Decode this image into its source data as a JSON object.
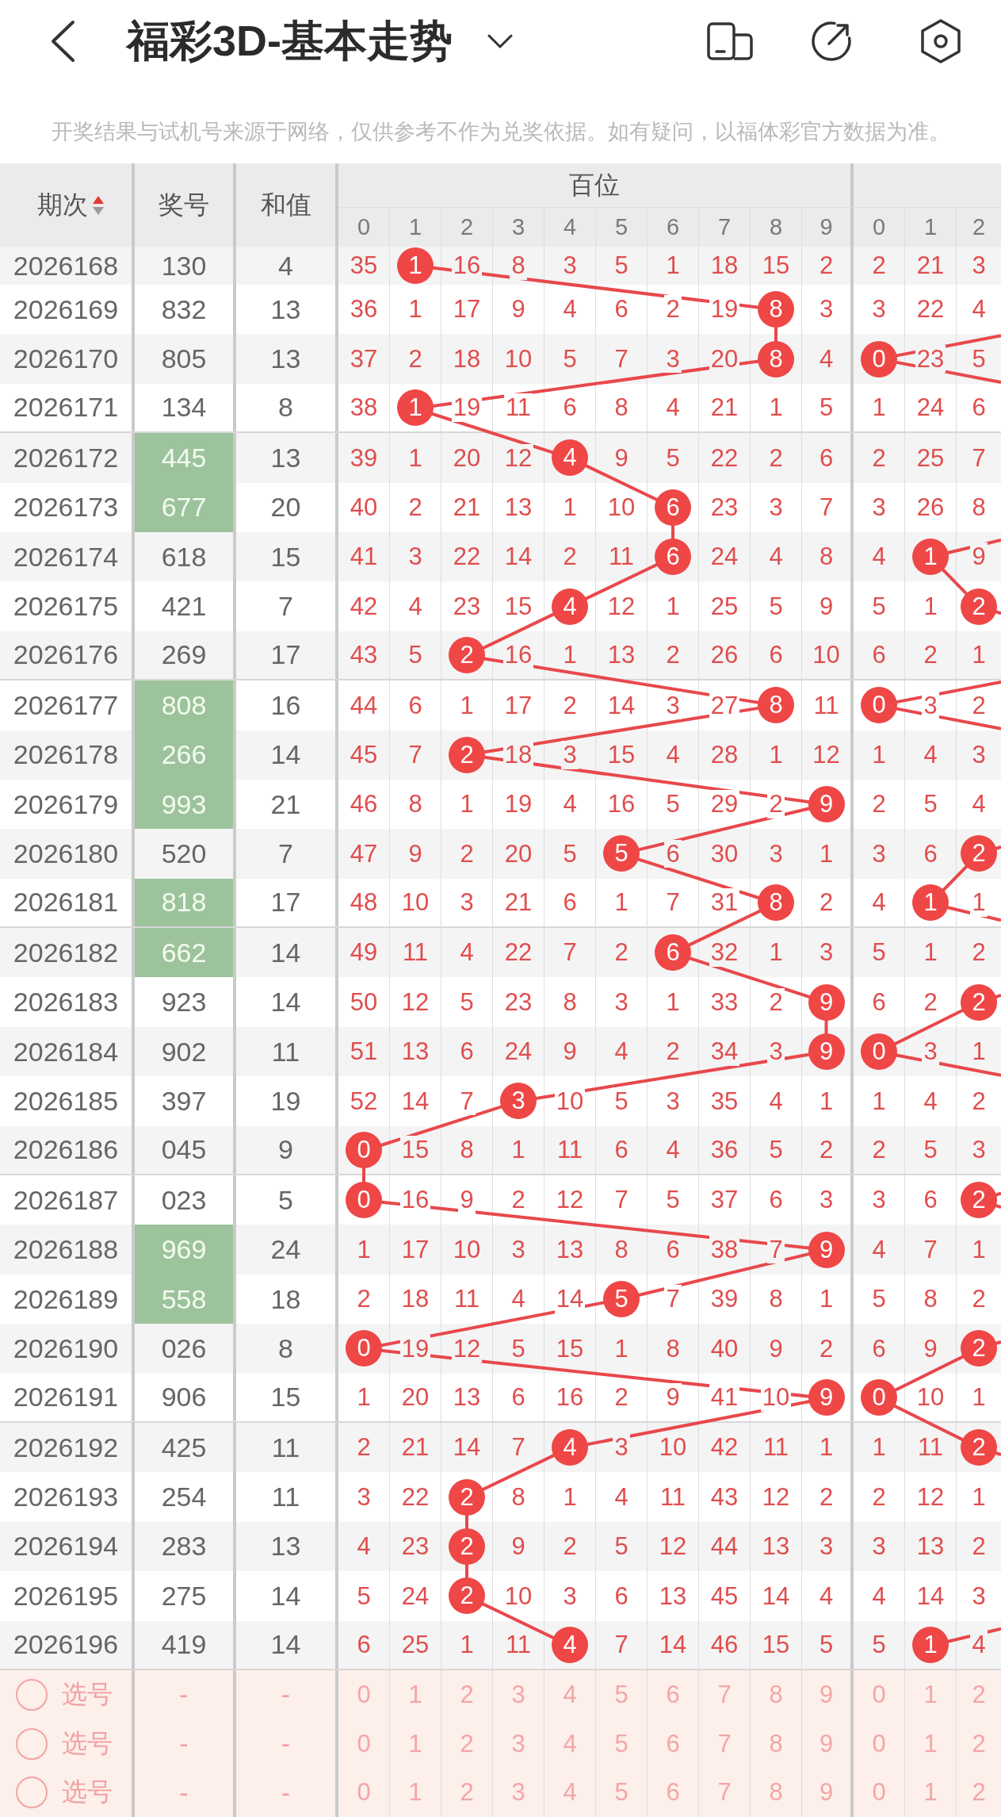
{
  "header": {
    "title": "福彩3D-基本走势"
  },
  "notice": "开奖结果与试机号来源于网络，仅供参考不作为兑奖依据。如有疑问，以福体彩官方数据为准。",
  "table": {
    "columns": [
      {
        "label": "期次",
        "sort_ascending": true
      },
      {
        "label": "奖号"
      },
      {
        "label": "和值"
      }
    ],
    "digit_groups": [
      {
        "label": "百位",
        "digits": [
          "0",
          "1",
          "2",
          "3",
          "4",
          "5",
          "6",
          "7",
          "8",
          "9"
        ]
      },
      {
        "digits": [
          "0",
          "1",
          "2"
        ]
      }
    ],
    "rows": [
      {
        "period": "2026168",
        "number": "130",
        "highlighted": false,
        "sum": "4",
        "hundreds": [
          {
            "text": "35",
            "hit": false
          },
          {
            "text": "1",
            "hit": true
          },
          {
            "text": "16",
            "hit": false
          },
          {
            "text": "8",
            "hit": false
          },
          {
            "text": "3",
            "hit": false
          },
          {
            "text": "5",
            "hit": false
          },
          {
            "text": "1",
            "hit": false
          },
          {
            "text": "18",
            "hit": false
          },
          {
            "text": "15",
            "hit": false
          },
          {
            "text": "2",
            "hit": false
          }
        ],
        "group_2": [
          {
            "text": "2",
            "hit": false
          },
          {
            "text": "21",
            "hit": false
          },
          {
            "text": "3",
            "hit": false
          }
        ]
      },
      {
        "period": "2026169",
        "number": "832",
        "highlighted": false,
        "sum": "13",
        "hundreds": [
          {
            "text": "36",
            "hit": false
          },
          {
            "text": "1",
            "hit": false
          },
          {
            "text": "17",
            "hit": false
          },
          {
            "text": "9",
            "hit": false
          },
          {
            "text": "4",
            "hit": false
          },
          {
            "text": "6",
            "hit": false
          },
          {
            "text": "2",
            "hit": false
          },
          {
            "text": "19",
            "hit": false
          },
          {
            "text": "8",
            "hit": true
          },
          {
            "text": "3",
            "hit": false
          }
        ],
        "group_2": [
          {
            "text": "3",
            "hit": false
          },
          {
            "text": "22",
            "hit": false
          },
          {
            "text": "4",
            "hit": false
          }
        ]
      },
      {
        "period": "2026170",
        "number": "805",
        "highlighted": false,
        "sum": "13",
        "hundreds": [
          {
            "text": "37",
            "hit": false
          },
          {
            "text": "2",
            "hit": false
          },
          {
            "text": "18",
            "hit": false
          },
          {
            "text": "10",
            "hit": false
          },
          {
            "text": "5",
            "hit": false
          },
          {
            "text": "7",
            "hit": false
          },
          {
            "text": "3",
            "hit": false
          },
          {
            "text": "20",
            "hit": false
          },
          {
            "text": "8",
            "hit": true
          },
          {
            "text": "4",
            "hit": false
          }
        ],
        "group_2": [
          {
            "text": "0",
            "hit": true
          },
          {
            "text": "23",
            "hit": false
          },
          {
            "text": "5",
            "hit": false
          }
        ]
      },
      {
        "period": "2026171",
        "number": "134",
        "highlighted": false,
        "sum": "8",
        "hundreds": [
          {
            "text": "38",
            "hit": false
          },
          {
            "text": "1",
            "hit": true
          },
          {
            "text": "19",
            "hit": false
          },
          {
            "text": "11",
            "hit": false
          },
          {
            "text": "6",
            "hit": false
          },
          {
            "text": "8",
            "hit": false
          },
          {
            "text": "4",
            "hit": false
          },
          {
            "text": "21",
            "hit": false
          },
          {
            "text": "1",
            "hit": false
          },
          {
            "text": "5",
            "hit": false
          }
        ],
        "group_2": [
          {
            "text": "1",
            "hit": false
          },
          {
            "text": "24",
            "hit": false
          },
          {
            "text": "6",
            "hit": false
          }
        ]
      },
      {
        "period": "2026172",
        "number": "445",
        "highlighted": true,
        "sum": "13",
        "hundreds": [
          {
            "text": "39",
            "hit": false
          },
          {
            "text": "1",
            "hit": false
          },
          {
            "text": "20",
            "hit": false
          },
          {
            "text": "12",
            "hit": false
          },
          {
            "text": "4",
            "hit": true
          },
          {
            "text": "9",
            "hit": false
          },
          {
            "text": "5",
            "hit": false
          },
          {
            "text": "22",
            "hit": false
          },
          {
            "text": "2",
            "hit": false
          },
          {
            "text": "6",
            "hit": false
          }
        ],
        "group_2": [
          {
            "text": "2",
            "hit": false
          },
          {
            "text": "25",
            "hit": false
          },
          {
            "text": "7",
            "hit": false
          }
        ]
      },
      {
        "period": "2026173",
        "number": "677",
        "highlighted": true,
        "sum": "20",
        "hundreds": [
          {
            "text": "40",
            "hit": false
          },
          {
            "text": "2",
            "hit": false
          },
          {
            "text": "21",
            "hit": false
          },
          {
            "text": "13",
            "hit": false
          },
          {
            "text": "1",
            "hit": false
          },
          {
            "text": "10",
            "hit": false
          },
          {
            "text": "6",
            "hit": true
          },
          {
            "text": "23",
            "hit": false
          },
          {
            "text": "3",
            "hit": false
          },
          {
            "text": "7",
            "hit": false
          }
        ],
        "group_2": [
          {
            "text": "3",
            "hit": false
          },
          {
            "text": "26",
            "hit": false
          },
          {
            "text": "8",
            "hit": false
          }
        ]
      },
      {
        "period": "2026174",
        "number": "618",
        "highlighted": false,
        "sum": "15",
        "hundreds": [
          {
            "text": "41",
            "hit": false
          },
          {
            "text": "3",
            "hit": false
          },
          {
            "text": "22",
            "hit": false
          },
          {
            "text": "14",
            "hit": false
          },
          {
            "text": "2",
            "hit": false
          },
          {
            "text": "11",
            "hit": false
          },
          {
            "text": "6",
            "hit": true
          },
          {
            "text": "24",
            "hit": false
          },
          {
            "text": "4",
            "hit": false
          },
          {
            "text": "8",
            "hit": false
          }
        ],
        "group_2": [
          {
            "text": "4",
            "hit": false
          },
          {
            "text": "1",
            "hit": true
          },
          {
            "text": "9",
            "hit": false
          }
        ]
      },
      {
        "period": "2026175",
        "number": "421",
        "highlighted": false,
        "sum": "7",
        "hundreds": [
          {
            "text": "42",
            "hit": false
          },
          {
            "text": "4",
            "hit": false
          },
          {
            "text": "23",
            "hit": false
          },
          {
            "text": "15",
            "hit": false
          },
          {
            "text": "4",
            "hit": true
          },
          {
            "text": "12",
            "hit": false
          },
          {
            "text": "1",
            "hit": false
          },
          {
            "text": "25",
            "hit": false
          },
          {
            "text": "5",
            "hit": false
          },
          {
            "text": "9",
            "hit": false
          }
        ],
        "group_2": [
          {
            "text": "5",
            "hit": false
          },
          {
            "text": "1",
            "hit": false
          },
          {
            "text": "2",
            "hit": true
          }
        ]
      },
      {
        "period": "2026176",
        "number": "269",
        "highlighted": false,
        "sum": "17",
        "hundreds": [
          {
            "text": "43",
            "hit": false
          },
          {
            "text": "5",
            "hit": false
          },
          {
            "text": "2",
            "hit": true
          },
          {
            "text": "16",
            "hit": false
          },
          {
            "text": "1",
            "hit": false
          },
          {
            "text": "13",
            "hit": false
          },
          {
            "text": "2",
            "hit": false
          },
          {
            "text": "26",
            "hit": false
          },
          {
            "text": "6",
            "hit": false
          },
          {
            "text": "10",
            "hit": false
          }
        ],
        "group_2": [
          {
            "text": "6",
            "hit": false
          },
          {
            "text": "2",
            "hit": false
          },
          {
            "text": "1",
            "hit": false
          }
        ]
      },
      {
        "period": "2026177",
        "number": "808",
        "highlighted": true,
        "sum": "16",
        "hundreds": [
          {
            "text": "44",
            "hit": false
          },
          {
            "text": "6",
            "hit": false
          },
          {
            "text": "1",
            "hit": false
          },
          {
            "text": "17",
            "hit": false
          },
          {
            "text": "2",
            "hit": false
          },
          {
            "text": "14",
            "hit": false
          },
          {
            "text": "3",
            "hit": false
          },
          {
            "text": "27",
            "hit": false
          },
          {
            "text": "8",
            "hit": true
          },
          {
            "text": "11",
            "hit": false
          }
        ],
        "group_2": [
          {
            "text": "0",
            "hit": true
          },
          {
            "text": "3",
            "hit": false
          },
          {
            "text": "2",
            "hit": false
          }
        ]
      },
      {
        "period": "2026178",
        "number": "266",
        "highlighted": true,
        "sum": "14",
        "hundreds": [
          {
            "text": "45",
            "hit": false
          },
          {
            "text": "7",
            "hit": false
          },
          {
            "text": "2",
            "hit": true
          },
          {
            "text": "18",
            "hit": false
          },
          {
            "text": "3",
            "hit": false
          },
          {
            "text": "15",
            "hit": false
          },
          {
            "text": "4",
            "hit": false
          },
          {
            "text": "28",
            "hit": false
          },
          {
            "text": "1",
            "hit": false
          },
          {
            "text": "12",
            "hit": false
          }
        ],
        "group_2": [
          {
            "text": "1",
            "hit": false
          },
          {
            "text": "4",
            "hit": false
          },
          {
            "text": "3",
            "hit": false
          }
        ]
      },
      {
        "period": "2026179",
        "number": "993",
        "highlighted": true,
        "sum": "21",
        "hundreds": [
          {
            "text": "46",
            "hit": false
          },
          {
            "text": "8",
            "hit": false
          },
          {
            "text": "1",
            "hit": false
          },
          {
            "text": "19",
            "hit": false
          },
          {
            "text": "4",
            "hit": false
          },
          {
            "text": "16",
            "hit": false
          },
          {
            "text": "5",
            "hit": false
          },
          {
            "text": "29",
            "hit": false
          },
          {
            "text": "2",
            "hit": false
          },
          {
            "text": "9",
            "hit": true
          }
        ],
        "group_2": [
          {
            "text": "2",
            "hit": false
          },
          {
            "text": "5",
            "hit": false
          },
          {
            "text": "4",
            "hit": false
          }
        ]
      },
      {
        "period": "2026180",
        "number": "520",
        "highlighted": false,
        "sum": "7",
        "hundreds": [
          {
            "text": "47",
            "hit": false
          },
          {
            "text": "9",
            "hit": false
          },
          {
            "text": "2",
            "hit": false
          },
          {
            "text": "20",
            "hit": false
          },
          {
            "text": "5",
            "hit": false
          },
          {
            "text": "5",
            "hit": true
          },
          {
            "text": "6",
            "hit": false
          },
          {
            "text": "30",
            "hit": false
          },
          {
            "text": "3",
            "hit": false
          },
          {
            "text": "1",
            "hit": false
          }
        ],
        "group_2": [
          {
            "text": "3",
            "hit": false
          },
          {
            "text": "6",
            "hit": false
          },
          {
            "text": "2",
            "hit": true
          }
        ]
      },
      {
        "period": "2026181",
        "number": "818",
        "highlighted": true,
        "sum": "17",
        "hundreds": [
          {
            "text": "48",
            "hit": false
          },
          {
            "text": "10",
            "hit": false
          },
          {
            "text": "3",
            "hit": false
          },
          {
            "text": "21",
            "hit": false
          },
          {
            "text": "6",
            "hit": false
          },
          {
            "text": "1",
            "hit": false
          },
          {
            "text": "7",
            "hit": false
          },
          {
            "text": "31",
            "hit": false
          },
          {
            "text": "8",
            "hit": true
          },
          {
            "text": "2",
            "hit": false
          }
        ],
        "group_2": [
          {
            "text": "4",
            "hit": false
          },
          {
            "text": "1",
            "hit": true
          },
          {
            "text": "1",
            "hit": false
          }
        ]
      },
      {
        "period": "2026182",
        "number": "662",
        "highlighted": true,
        "sum": "14",
        "hundreds": [
          {
            "text": "49",
            "hit": false
          },
          {
            "text": "11",
            "hit": false
          },
          {
            "text": "4",
            "hit": false
          },
          {
            "text": "22",
            "hit": false
          },
          {
            "text": "7",
            "hit": false
          },
          {
            "text": "2",
            "hit": false
          },
          {
            "text": "6",
            "hit": true
          },
          {
            "text": "32",
            "hit": false
          },
          {
            "text": "1",
            "hit": false
          },
          {
            "text": "3",
            "hit": false
          }
        ],
        "group_2": [
          {
            "text": "5",
            "hit": false
          },
          {
            "text": "1",
            "hit": false
          },
          {
            "text": "2",
            "hit": false
          }
        ]
      },
      {
        "period": "2026183",
        "number": "923",
        "highlighted": false,
        "sum": "14",
        "hundreds": [
          {
            "text": "50",
            "hit": false
          },
          {
            "text": "12",
            "hit": false
          },
          {
            "text": "5",
            "hit": false
          },
          {
            "text": "23",
            "hit": false
          },
          {
            "text": "8",
            "hit": false
          },
          {
            "text": "3",
            "hit": false
          },
          {
            "text": "1",
            "hit": false
          },
          {
            "text": "33",
            "hit": false
          },
          {
            "text": "2",
            "hit": false
          },
          {
            "text": "9",
            "hit": true
          }
        ],
        "group_2": [
          {
            "text": "6",
            "hit": false
          },
          {
            "text": "2",
            "hit": false
          },
          {
            "text": "2",
            "hit": true
          }
        ]
      },
      {
        "period": "2026184",
        "number": "902",
        "highlighted": false,
        "sum": "11",
        "hundreds": [
          {
            "text": "51",
            "hit": false
          },
          {
            "text": "13",
            "hit": false
          },
          {
            "text": "6",
            "hit": false
          },
          {
            "text": "24",
            "hit": false
          },
          {
            "text": "9",
            "hit": false
          },
          {
            "text": "4",
            "hit": false
          },
          {
            "text": "2",
            "hit": false
          },
          {
            "text": "34",
            "hit": false
          },
          {
            "text": "3",
            "hit": false
          },
          {
            "text": "9",
            "hit": true
          }
        ],
        "group_2": [
          {
            "text": "0",
            "hit": true
          },
          {
            "text": "3",
            "hit": false
          },
          {
            "text": "1",
            "hit": false
          }
        ]
      },
      {
        "period": "2026185",
        "number": "397",
        "highlighted": false,
        "sum": "19",
        "hundreds": [
          {
            "text": "52",
            "hit": false
          },
          {
            "text": "14",
            "hit": false
          },
          {
            "text": "7",
            "hit": false
          },
          {
            "text": "3",
            "hit": true
          },
          {
            "text": "10",
            "hit": false
          },
          {
            "text": "5",
            "hit": false
          },
          {
            "text": "3",
            "hit": false
          },
          {
            "text": "35",
            "hit": false
          },
          {
            "text": "4",
            "hit": false
          },
          {
            "text": "1",
            "hit": false
          }
        ],
        "group_2": [
          {
            "text": "1",
            "hit": false
          },
          {
            "text": "4",
            "hit": false
          },
          {
            "text": "2",
            "hit": false
          }
        ]
      },
      {
        "period": "2026186",
        "number": "045",
        "highlighted": false,
        "sum": "9",
        "hundreds": [
          {
            "text": "0",
            "hit": true
          },
          {
            "text": "15",
            "hit": false
          },
          {
            "text": "8",
            "hit": false
          },
          {
            "text": "1",
            "hit": false
          },
          {
            "text": "11",
            "hit": false
          },
          {
            "text": "6",
            "hit": false
          },
          {
            "text": "4",
            "hit": false
          },
          {
            "text": "36",
            "hit": false
          },
          {
            "text": "5",
            "hit": false
          },
          {
            "text": "2",
            "hit": false
          }
        ],
        "group_2": [
          {
            "text": "2",
            "hit": false
          },
          {
            "text": "5",
            "hit": false
          },
          {
            "text": "3",
            "hit": false
          }
        ]
      },
      {
        "period": "2026187",
        "number": "023",
        "highlighted": false,
        "sum": "5",
        "hundreds": [
          {
            "text": "0",
            "hit": true
          },
          {
            "text": "16",
            "hit": false
          },
          {
            "text": "9",
            "hit": false
          },
          {
            "text": "2",
            "hit": false
          },
          {
            "text": "12",
            "hit": false
          },
          {
            "text": "7",
            "hit": false
          },
          {
            "text": "5",
            "hit": false
          },
          {
            "text": "37",
            "hit": false
          },
          {
            "text": "6",
            "hit": false
          },
          {
            "text": "3",
            "hit": false
          }
        ],
        "group_2": [
          {
            "text": "3",
            "hit": false
          },
          {
            "text": "6",
            "hit": false
          },
          {
            "text": "2",
            "hit": true
          }
        ]
      },
      {
        "period": "2026188",
        "number": "969",
        "highlighted": true,
        "sum": "24",
        "hundreds": [
          {
            "text": "1",
            "hit": false
          },
          {
            "text": "17",
            "hit": false
          },
          {
            "text": "10",
            "hit": false
          },
          {
            "text": "3",
            "hit": false
          },
          {
            "text": "13",
            "hit": false
          },
          {
            "text": "8",
            "hit": false
          },
          {
            "text": "6",
            "hit": false
          },
          {
            "text": "38",
            "hit": false
          },
          {
            "text": "7",
            "hit": false
          },
          {
            "text": "9",
            "hit": true
          }
        ],
        "group_2": [
          {
            "text": "4",
            "hit": false
          },
          {
            "text": "7",
            "hit": false
          },
          {
            "text": "1",
            "hit": false
          }
        ]
      },
      {
        "period": "2026189",
        "number": "558",
        "highlighted": true,
        "sum": "18",
        "hundreds": [
          {
            "text": "2",
            "hit": false
          },
          {
            "text": "18",
            "hit": false
          },
          {
            "text": "11",
            "hit": false
          },
          {
            "text": "4",
            "hit": false
          },
          {
            "text": "14",
            "hit": false
          },
          {
            "text": "5",
            "hit": true
          },
          {
            "text": "7",
            "hit": false
          },
          {
            "text": "39",
            "hit": false
          },
          {
            "text": "8",
            "hit": false
          },
          {
            "text": "1",
            "hit": false
          }
        ],
        "group_2": [
          {
            "text": "5",
            "hit": false
          },
          {
            "text": "8",
            "hit": false
          },
          {
            "text": "2",
            "hit": false
          }
        ]
      },
      {
        "period": "2026190",
        "number": "026",
        "highlighted": false,
        "sum": "8",
        "hundreds": [
          {
            "text": "0",
            "hit": true
          },
          {
            "text": "19",
            "hit": false
          },
          {
            "text": "12",
            "hit": false
          },
          {
            "text": "5",
            "hit": false
          },
          {
            "text": "15",
            "hit": false
          },
          {
            "text": "1",
            "hit": false
          },
          {
            "text": "8",
            "hit": false
          },
          {
            "text": "40",
            "hit": false
          },
          {
            "text": "9",
            "hit": false
          },
          {
            "text": "2",
            "hit": false
          }
        ],
        "group_2": [
          {
            "text": "6",
            "hit": false
          },
          {
            "text": "9",
            "hit": false
          },
          {
            "text": "2",
            "hit": true
          }
        ]
      },
      {
        "period": "2026191",
        "number": "906",
        "highlighted": false,
        "sum": "15",
        "hundreds": [
          {
            "text": "1",
            "hit": false
          },
          {
            "text": "20",
            "hit": false
          },
          {
            "text": "13",
            "hit": false
          },
          {
            "text": "6",
            "hit": false
          },
          {
            "text": "16",
            "hit": false
          },
          {
            "text": "2",
            "hit": false
          },
          {
            "text": "9",
            "hit": false
          },
          {
            "text": "41",
            "hit": false
          },
          {
            "text": "10",
            "hit": false
          },
          {
            "text": "9",
            "hit": true
          }
        ],
        "group_2": [
          {
            "text": "0",
            "hit": true
          },
          {
            "text": "10",
            "hit": false
          },
          {
            "text": "1",
            "hit": false
          }
        ]
      },
      {
        "period": "2026192",
        "number": "425",
        "highlighted": false,
        "sum": "11",
        "hundreds": [
          {
            "text": "2",
            "hit": false
          },
          {
            "text": "21",
            "hit": false
          },
          {
            "text": "14",
            "hit": false
          },
          {
            "text": "7",
            "hit": false
          },
          {
            "text": "4",
            "hit": true
          },
          {
            "text": "3",
            "hit": false
          },
          {
            "text": "10",
            "hit": false
          },
          {
            "text": "42",
            "hit": false
          },
          {
            "text": "11",
            "hit": false
          },
          {
            "text": "1",
            "hit": false
          }
        ],
        "group_2": [
          {
            "text": "1",
            "hit": false
          },
          {
            "text": "11",
            "hit": false
          },
          {
            "text": "2",
            "hit": true
          }
        ]
      },
      {
        "period": "2026193",
        "number": "254",
        "highlighted": false,
        "sum": "11",
        "hundreds": [
          {
            "text": "3",
            "hit": false
          },
          {
            "text": "22",
            "hit": false
          },
          {
            "text": "2",
            "hit": true
          },
          {
            "text": "8",
            "hit": false
          },
          {
            "text": "1",
            "hit": false
          },
          {
            "text": "4",
            "hit": false
          },
          {
            "text": "11",
            "hit": false
          },
          {
            "text": "43",
            "hit": false
          },
          {
            "text": "12",
            "hit": false
          },
          {
            "text": "2",
            "hit": false
          }
        ],
        "group_2": [
          {
            "text": "2",
            "hit": false
          },
          {
            "text": "12",
            "hit": false
          },
          {
            "text": "1",
            "hit": false
          }
        ]
      },
      {
        "period": "2026194",
        "number": "283",
        "highlighted": false,
        "sum": "13",
        "hundreds": [
          {
            "text": "4",
            "hit": false
          },
          {
            "text": "23",
            "hit": false
          },
          {
            "text": "2",
            "hit": true
          },
          {
            "text": "9",
            "hit": false
          },
          {
            "text": "2",
            "hit": false
          },
          {
            "text": "5",
            "hit": false
          },
          {
            "text": "12",
            "hit": false
          },
          {
            "text": "44",
            "hit": false
          },
          {
            "text": "13",
            "hit": false
          },
          {
            "text": "3",
            "hit": false
          }
        ],
        "group_2": [
          {
            "text": "3",
            "hit": false
          },
          {
            "text": "13",
            "hit": false
          },
          {
            "text": "2",
            "hit": false
          }
        ]
      },
      {
        "period": "2026195",
        "number": "275",
        "highlighted": false,
        "sum": "14",
        "hundreds": [
          {
            "text": "5",
            "hit": false
          },
          {
            "text": "24",
            "hit": false
          },
          {
            "text": "2",
            "hit": true
          },
          {
            "text": "10",
            "hit": false
          },
          {
            "text": "3",
            "hit": false
          },
          {
            "text": "6",
            "hit": false
          },
          {
            "text": "13",
            "hit": false
          },
          {
            "text": "45",
            "hit": false
          },
          {
            "text": "14",
            "hit": false
          },
          {
            "text": "4",
            "hit": false
          }
        ],
        "group_2": [
          {
            "text": "4",
            "hit": false
          },
          {
            "text": "14",
            "hit": false
          },
          {
            "text": "3",
            "hit": false
          }
        ]
      },
      {
        "period": "2026196",
        "number": "419",
        "highlighted": false,
        "sum": "14",
        "hundreds": [
          {
            "text": "6",
            "hit": false
          },
          {
            "text": "25",
            "hit": false
          },
          {
            "text": "1",
            "hit": false
          },
          {
            "text": "11",
            "hit": false
          },
          {
            "text": "4",
            "hit": true
          },
          {
            "text": "7",
            "hit": false
          },
          {
            "text": "14",
            "hit": false
          },
          {
            "text": "46",
            "hit": false
          },
          {
            "text": "15",
            "hit": false
          },
          {
            "text": "5",
            "hit": false
          }
        ],
        "group_2": [
          {
            "text": "5",
            "hit": false
          },
          {
            "text": "1",
            "hit": true
          },
          {
            "text": "4",
            "hit": false
          }
        ]
      }
    ],
    "pick_rows": [
      {
        "selected": false,
        "label": "选号",
        "number": "-",
        "sum": "-",
        "hundreds": [
          {
            "text": "0",
            "selected": false
          },
          {
            "text": "1",
            "selected": false
          },
          {
            "text": "2",
            "selected": false
          },
          {
            "text": "3",
            "selected": false
          },
          {
            "text": "4",
            "selected": false
          },
          {
            "text": "5",
            "selected": false
          },
          {
            "text": "6",
            "selected": false
          },
          {
            "text": "7",
            "selected": false
          },
          {
            "text": "8",
            "selected": false
          },
          {
            "text": "9",
            "selected": false
          }
        ],
        "group_2": [
          {
            "text": "0",
            "selected": false
          },
          {
            "text": "1",
            "selected": false
          },
          {
            "text": "2",
            "selected": false
          }
        ]
      },
      {
        "selected": false,
        "label": "选号",
        "number": "-",
        "sum": "-",
        "hundreds": [
          {
            "text": "0",
            "selected": false
          },
          {
            "text": "1",
            "selected": false
          },
          {
            "text": "2",
            "selected": false
          },
          {
            "text": "3",
            "selected": false
          },
          {
            "text": "4",
            "selected": false
          },
          {
            "text": "5",
            "selected": false
          },
          {
            "text": "6",
            "selected": false
          },
          {
            "text": "7",
            "selected": false
          },
          {
            "text": "8",
            "selected": false
          },
          {
            "text": "9",
            "selected": false
          }
        ],
        "group_2": [
          {
            "text": "0",
            "selected": false
          },
          {
            "text": "1",
            "selected": false
          },
          {
            "text": "2",
            "selected": false
          }
        ]
      },
      {
        "selected": false,
        "label": "选号",
        "number": "-",
        "sum": "-",
        "hundreds": [
          {
            "text": "0",
            "selected": false
          },
          {
            "text": "1",
            "selected": false
          },
          {
            "text": "2",
            "selected": false
          },
          {
            "text": "3",
            "selected": false
          },
          {
            "text": "4",
            "selected": false
          },
          {
            "text": "5",
            "selected": false
          },
          {
            "text": "6",
            "selected": false
          },
          {
            "text": "7",
            "selected": false
          },
          {
            "text": "8",
            "selected": false
          },
          {
            "text": "9",
            "selected": false
          }
        ],
        "group_2": [
          {
            "text": "0",
            "selected": false
          },
          {
            "text": "1",
            "selected": false
          },
          {
            "text": "2",
            "selected": false
          }
        ]
      }
    ]
  }
}
